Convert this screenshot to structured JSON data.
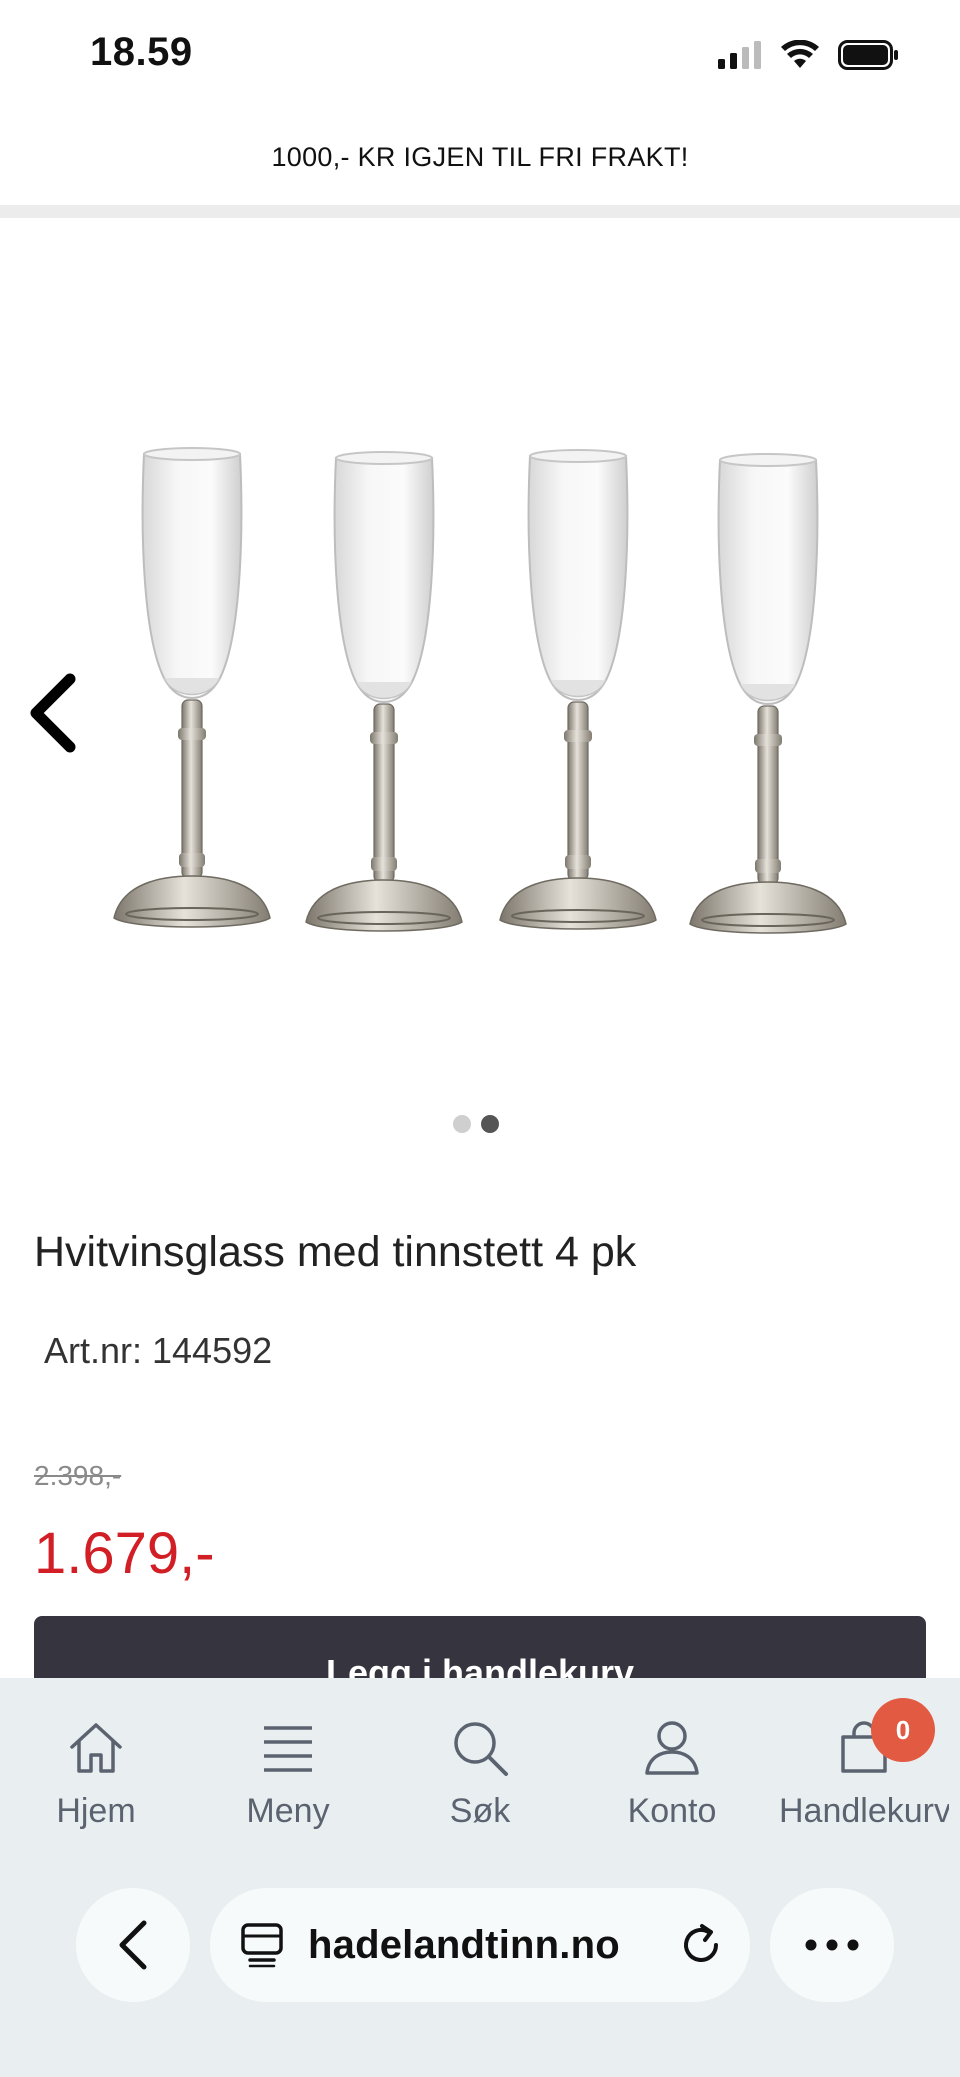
{
  "status_bar": {
    "time": "18.59",
    "icons": [
      "signal-icon",
      "wifi-icon",
      "battery-icon"
    ]
  },
  "promo": {
    "text": "1000,- KR IGJEN TIL FRI FRAKT!"
  },
  "gallery": {
    "dots_total": 2,
    "active_dot": 2
  },
  "product": {
    "title": "Hvitvinsglass med tinnstett 4 pk",
    "art_nr": "Art.nr: 144592",
    "old_price": "2.398,-",
    "new_price": "1.679,-",
    "add_to_cart": "Legg i handlekurv"
  },
  "bottom_nav": {
    "items": [
      {
        "label": "Hjem",
        "icon": "home-icon"
      },
      {
        "label": "Meny",
        "icon": "menu-icon"
      },
      {
        "label": "Søk",
        "icon": "search-icon"
      },
      {
        "label": "Konto",
        "icon": "user-icon"
      },
      {
        "label": "Handlekurv",
        "icon": "cart-icon"
      }
    ],
    "cart_count": "0"
  },
  "browser": {
    "url": "hadelandtinn.no"
  },
  "colors": {
    "price_red": "#d21f26",
    "button_dark": "#36353f",
    "badge": "#e35a42",
    "nav_bg": "#e9eff0"
  }
}
